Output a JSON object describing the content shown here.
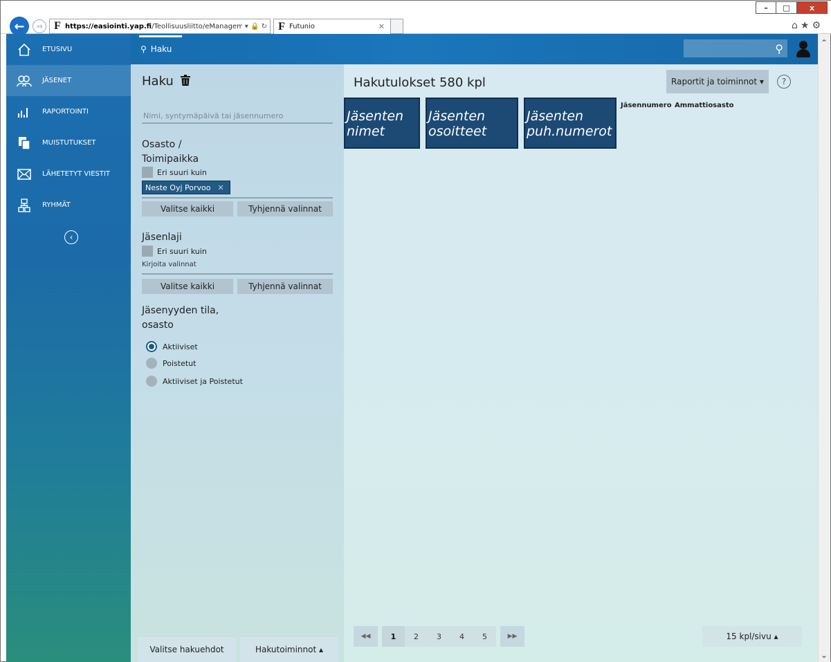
{
  "browser": {
    "url_host": "https://easiointi.yap.fi",
    "url_path": "/Teollisuusliitto/eManagement#/se",
    "tab_title": "Futunio",
    "favicon_letter": "F",
    "win_min": "–",
    "win_max": "□",
    "win_close": "x"
  },
  "appbar": {
    "home_label": "ETUSIVU",
    "search_tab": "Haku"
  },
  "sidebar": {
    "items": [
      {
        "label": "ETUSIVU",
        "icon": "home-icon"
      },
      {
        "label": "JÄSENET",
        "icon": "members-icon"
      },
      {
        "label": "RAPORTOINTI",
        "icon": "chart-icon"
      },
      {
        "label": "MUISTUTUKSET",
        "icon": "reminder-icon"
      },
      {
        "label": "LÄHETETYT VIESTIT",
        "icon": "mail-icon"
      },
      {
        "label": "RYHMÄT",
        "icon": "groups-icon"
      }
    ]
  },
  "filter": {
    "title": "Haku",
    "search_placeholder": "Nimi, syntymäpäivä tai jäsennumero",
    "section1_title_line1": "Osasto /",
    "section1_title_line2": "Toimipaikka",
    "not_equal_label": "Eri suuri kuin",
    "chip_label": "Neste Oyj Porvoo",
    "select_all": "Valitse kaikki",
    "clear_selections": "Tyhjennä valinnat",
    "section2_title": "Jäsenlaji",
    "type_selections": "Kirjoita valinnat",
    "section3_title_line1": "Jäsenyyden tila,",
    "section3_title_line2": "osasto",
    "radio_options": [
      "Aktiiviset",
      "Poistetut",
      "Aktiiviset ja Poistetut"
    ],
    "radio_selected": "Aktiiviset",
    "bottom_left": "Valitse hakuehdot",
    "bottom_right": "Hakutoiminnot ▴"
  },
  "results": {
    "title": "Hakutulokset 580 kpl",
    "reports_button": "Raportit ja toiminnot ▾",
    "help": "?",
    "column_boxes": [
      "Jäsenten nimet",
      "Jäsenten osoitteet",
      "Jäsenten puh.numerot"
    ],
    "column_headers": [
      "Jäsennumero",
      "Ammattiosasto"
    ],
    "pager": {
      "first": "◀◀",
      "pages": [
        "1",
        "2",
        "3",
        "4",
        "5"
      ],
      "current": "1",
      "next": "▶▶"
    },
    "per_page": "15 kpl/sivu ▴"
  }
}
